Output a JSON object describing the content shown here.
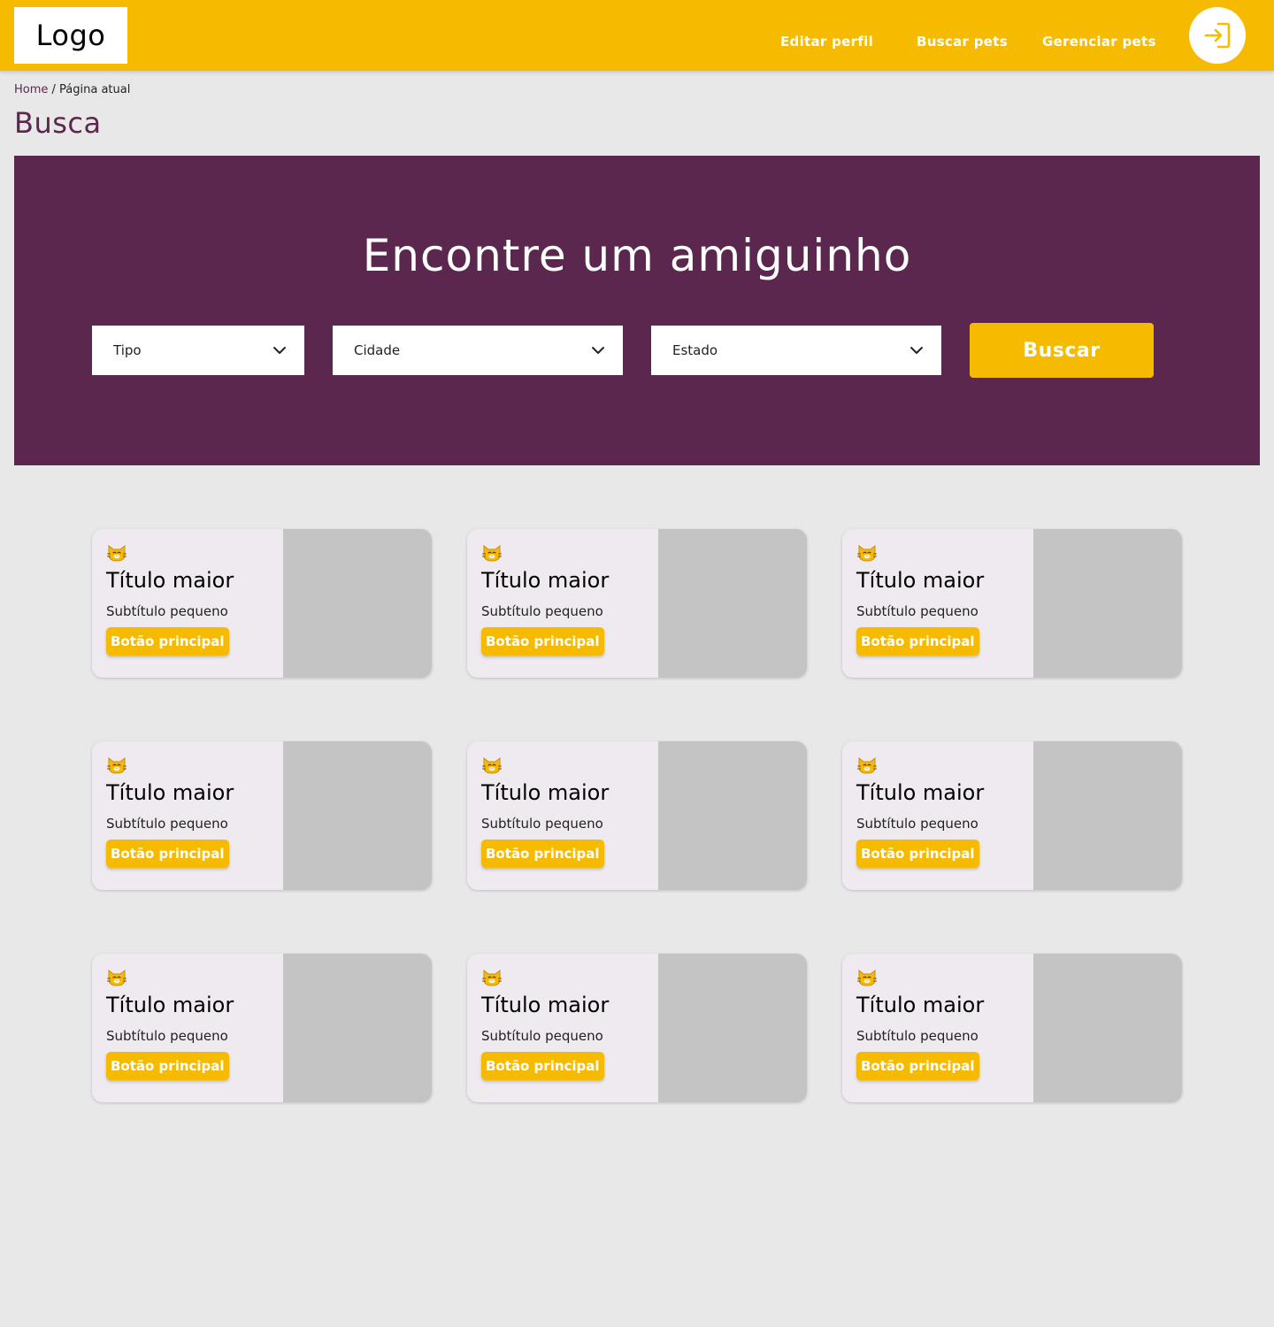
{
  "header": {
    "logo": "Logo",
    "nav": [
      "Editar perfil",
      "Buscar pets",
      "Gerenciar pets"
    ],
    "login_icon": "login-arrow-icon",
    "brand_color": "#f6bb00"
  },
  "breadcrumb": {
    "home": "Home",
    "separator": " / ",
    "current": "Página atual"
  },
  "page": {
    "title": "Busca"
  },
  "search": {
    "headline": "Encontre um amiguinho",
    "filters": [
      "Tipo",
      "Cidade",
      "Estado"
    ],
    "button": "Buscar",
    "background_color": "#5b274e"
  },
  "cards": [
    {
      "title": "Título maior",
      "subtitle": "Subtítulo pequeno",
      "button": "Botão principal",
      "icon": "cat-icon"
    },
    {
      "title": "Título maior",
      "subtitle": "Subtítulo pequeno",
      "button": "Botão principal",
      "icon": "cat-icon"
    },
    {
      "title": "Título maior",
      "subtitle": "Subtítulo pequeno",
      "button": "Botão principal",
      "icon": "cat-icon"
    },
    {
      "title": "Título maior",
      "subtitle": "Subtítulo pequeno",
      "button": "Botão principal",
      "icon": "cat-icon"
    },
    {
      "title": "Título maior",
      "subtitle": "Subtítulo pequeno",
      "button": "Botão principal",
      "icon": "cat-icon"
    },
    {
      "title": "Título maior",
      "subtitle": "Subtítulo pequeno",
      "button": "Botão principal",
      "icon": "cat-icon"
    },
    {
      "title": "Título maior",
      "subtitle": "Subtítulo pequeno",
      "button": "Botão principal",
      "icon": "cat-icon"
    },
    {
      "title": "Título maior",
      "subtitle": "Subtítulo pequeno",
      "button": "Botão principal",
      "icon": "cat-icon"
    },
    {
      "title": "Título maior",
      "subtitle": "Subtítulo pequeno",
      "button": "Botão principal",
      "icon": "cat-icon"
    }
  ]
}
